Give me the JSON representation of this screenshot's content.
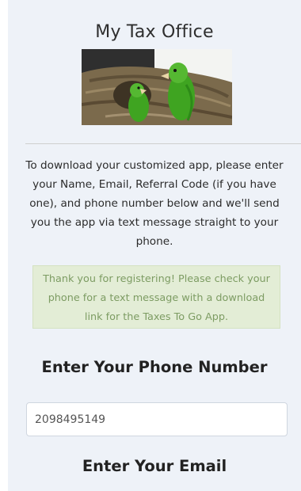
{
  "header": {
    "title": "My Tax Office"
  },
  "logo": {
    "description_icon": "parrots-photo-icon",
    "colors": {
      "sky": "#f3f4f2",
      "nest": "#7b6a4c",
      "parrot": "#3fa421",
      "dark": "#2f2f2f"
    }
  },
  "intro": {
    "text": "To download your customized app, please enter your Name, Email, Referral Code (if you have one), and phone number below and we'll send you the app via text message straight to your phone."
  },
  "notice": {
    "text": "Thank you for registering! Please check your phone for a text message with a download link for the Taxes To Go App.",
    "color": "#7d9c63",
    "background": "#e3edd6"
  },
  "phone": {
    "heading": "Enter Your Phone Number",
    "value": "2098495149"
  },
  "email": {
    "heading": "Enter Your Email"
  }
}
